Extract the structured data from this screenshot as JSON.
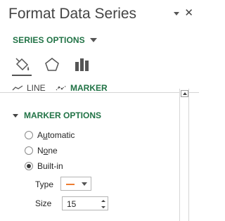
{
  "pane": {
    "title": "Format Data Series",
    "controls": [
      {
        "icon": "chevron-down-icon"
      },
      {
        "icon": "close-icon",
        "glyph": "✕"
      }
    ]
  },
  "series_options": {
    "label": "SERIES OPTIONS"
  },
  "category_icons": [
    {
      "icon": "fill-line-icon",
      "active": true
    },
    {
      "icon": "effects-pentagon-icon",
      "active": false
    },
    {
      "icon": "series-options-bar-chart-icon",
      "active": false
    }
  ],
  "tabs": {
    "line_label": "LINE",
    "marker_label": "MARKER",
    "active": "marker"
  },
  "marker_options": {
    "header": "MARKER OPTIONS",
    "radio_automatic": {
      "prefix": "A",
      "underline": "u",
      "suffix": "tomatic",
      "checked": false
    },
    "radio_none": {
      "prefix": "N",
      "underline": "o",
      "suffix": "ne",
      "checked": false
    },
    "radio_builtin": {
      "label": "Built-in",
      "checked": true
    },
    "type_label": "Type",
    "type_value": "dash",
    "size_label": "Size",
    "size_value": "15"
  },
  "colors": {
    "accent_green": "#217346",
    "marker_orange": "#ed7d31"
  }
}
